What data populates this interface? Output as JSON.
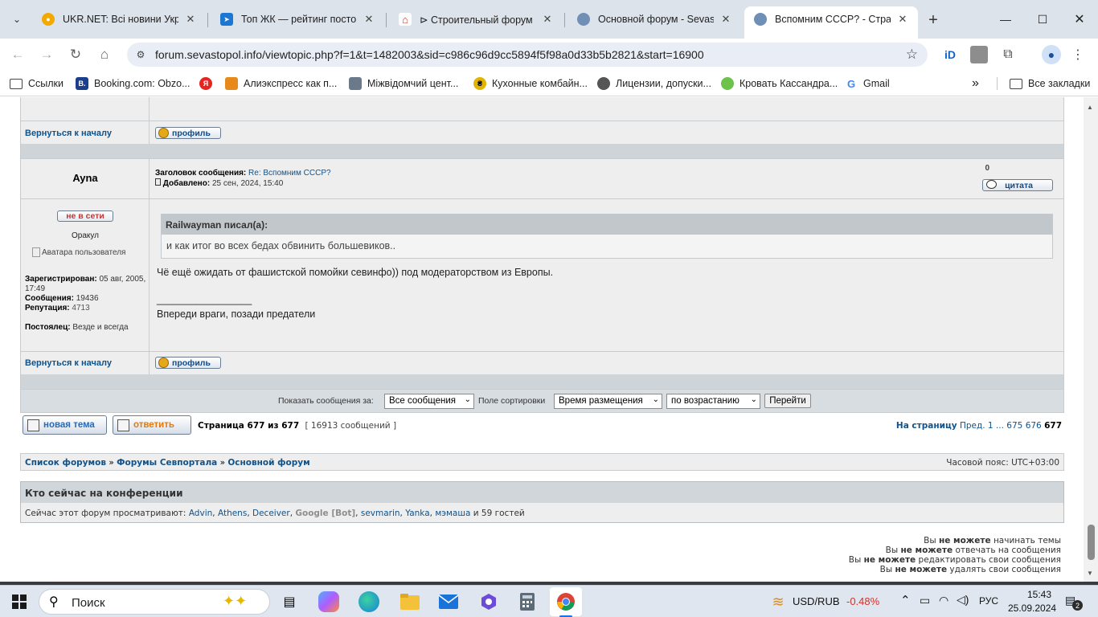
{
  "browser": {
    "tabs": [
      {
        "label": "UKR.NET: Всі новини Україн",
        "favicon": "ukrnet-favicon",
        "color": "#f2a900"
      },
      {
        "label": "Топ ЖК — рейтинг постов",
        "favicon": "bird-favicon",
        "color": "#1b77d2"
      },
      {
        "label": "⊳ Строительный форум Ук",
        "favicon": "house-favicon",
        "color": "#c0392b"
      },
      {
        "label": "Основной форум - Sevasto",
        "favicon": "globe-favicon",
        "color": "#6f8fb6"
      },
      {
        "label": "Вспомним СССР? - Страни",
        "favicon": "globe-favicon",
        "color": "#6f8fb6"
      }
    ],
    "close_glyph": "✕",
    "new_tab": "+",
    "url": "forum.sevastopol.info/viewtopic.php?f=1&t=1482003&sid=c986c96d9cc5894f5f98a0d33b5b2821&start=16900",
    "bookmarks": [
      {
        "label": "Ссылки",
        "icon": "folder-icon",
        "color": "#444"
      },
      {
        "label": "Booking.com: Obzo...",
        "icon": "booking-icon",
        "color": "#1c3f8c",
        "glyph": "B."
      },
      {
        "label": "",
        "icon": "yandex-icon",
        "color": "#e52620",
        "glyph": "Я"
      },
      {
        "label": "Алиэкспресс как п...",
        "icon": "aliexpress-icon",
        "color": "#e8891c",
        "glyph": ""
      },
      {
        "label": "Міжвідомчий цент...",
        "icon": "grid-icon",
        "color": "#6a7a8a",
        "glyph": ""
      },
      {
        "label": "Кухонные комбайн...",
        "icon": "coin-icon",
        "color": "#e0b400",
        "glyph": "₴"
      },
      {
        "label": "Лицензии, допуски...",
        "icon": "globe-icon",
        "color": "#555",
        "glyph": ""
      },
      {
        "label": "Кровать Кассандра...",
        "icon": "puzzle-icon",
        "color": "#6cc24a",
        "glyph": ""
      },
      {
        "label": "Gmail",
        "icon": "google-icon",
        "color": "#ffffff",
        "glyph": "G"
      }
    ],
    "more_bookmarks": "»",
    "all_bookmarks": "Все закладки"
  },
  "forum": {
    "back_to_top": "Вернуться к началу",
    "profile_btn": "профиль",
    "post": {
      "author": "Ayna",
      "subject_label": "Заголовок сообщения:",
      "subject": "Re: Вспомним СССР?",
      "added_label": "Добавлено:",
      "added": "25 сен, 2024, 15:40",
      "counter": "0",
      "quote_btn": "цитата",
      "status": "не в сети",
      "rank": "Оракул",
      "avatar_alt": "Аватара пользователя",
      "registered_label": "Зарегистрирован:",
      "registered": "05 авг, 2005, 17:49",
      "posts_label": "Сообщения:",
      "posts": "19436",
      "rep_label": "Репутация:",
      "rep": "4713",
      "location_label": "Постоялец:",
      "location": "Везде и всегда",
      "quote_header": "Railwayman писал(а):",
      "quote_text": "и как итог во всех бедах обвинить большевиков..",
      "body": "Чё ещё ожидать от фашистской помойки севинфо)) под модераторством из Европы.",
      "sig_line": "_________________",
      "signature": "Впереди враги, позади предатели"
    },
    "sort": {
      "show_label": "Показать сообщения за:",
      "show_value": "Все сообщения",
      "sort_label": "Поле сортировки",
      "sort_value": "Время размещения",
      "order_value": "по возрастанию",
      "go": "Перейти"
    },
    "new_topic": "новая тема",
    "reply": "ответить",
    "page_info": "Страница 677 из 677",
    "msg_count": "[ 16913 сообщений ]",
    "to_page": "На страницу",
    "pager_prev": "Пред.",
    "pager_1": "1",
    "pager_dots": "...",
    "pager_675": "675",
    "pager_676": "676",
    "pager_677": "677",
    "crumbs": [
      "Список форумов",
      "Форумы Севпортала",
      "Основной форум"
    ],
    "crumb_sep": "»",
    "timezone": "Часовой пояс: UTC+03:00",
    "online_title": "Кто сейчас на конференции",
    "online_prefix": "Сейчас этот форум просматривают:",
    "online_users": [
      "Advin",
      "Athens",
      "Deceiver",
      "Google [Bot]",
      "sevmarin",
      "Yanka",
      "мэмаша"
    ],
    "online_suffix": "и 59 гостей",
    "perm1_a": "Вы",
    "perm1_b": "не можете",
    "perm1_c": "начинать темы",
    "perm2_a": "Вы",
    "perm2_b": "не можете",
    "perm2_c": "отвечать на сообщения",
    "perm3_a": "Вы",
    "perm3_b": "не можете",
    "perm3_c": "редактировать свои сообщения",
    "perm4_a": "Вы",
    "perm4_b": "не можете",
    "perm4_c": "удалять свои сообщения"
  },
  "taskbar": {
    "search_placeholder": "Поиск",
    "currency": "USD/RUB",
    "currency_change": "-0.48%",
    "lang": "РУС",
    "time": "15:43",
    "date": "25.09.2024",
    "notifications": "2"
  },
  "colors": {
    "link": "#105289",
    "row_bg": "#eeeeee",
    "sep": "#cfd4d9",
    "offline": "#cc3333",
    "negative": "#d0332b"
  }
}
